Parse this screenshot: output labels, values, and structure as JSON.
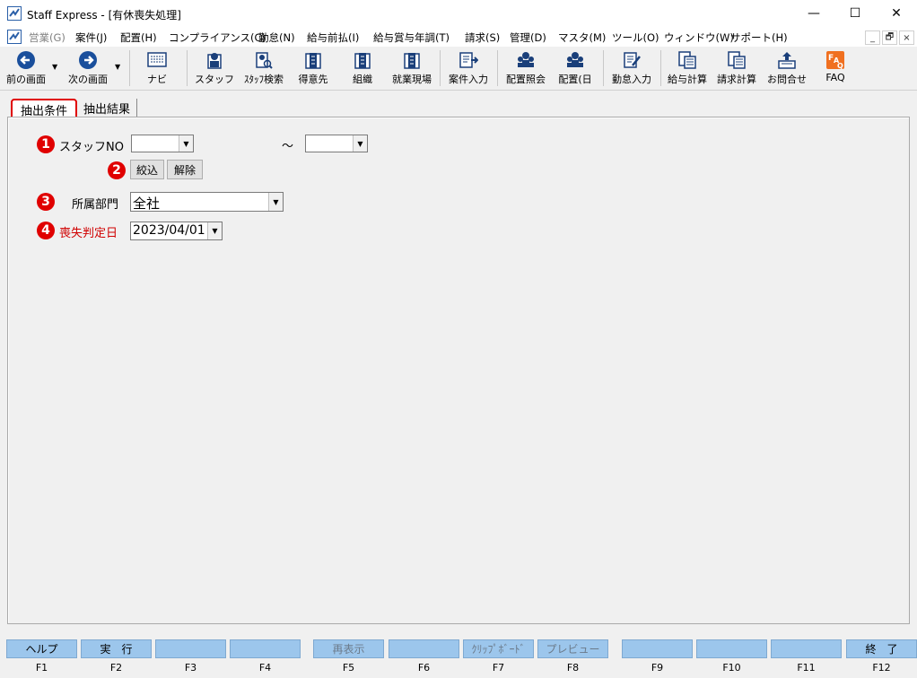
{
  "window": {
    "title": "Staff Express - [有休喪失処理]",
    "controls": {
      "minimize": "—",
      "maximize": "☐",
      "close": "✕"
    }
  },
  "menu": {
    "items": [
      "営業(G)",
      "案件(J)",
      "配置(H)",
      "コンプライアンス(C)",
      "勤怠(N)",
      "給与前払(I)",
      "給与賞与年調(T)",
      "請求(S)",
      "管理(D)",
      "マスタ(M)",
      "ツール(O)",
      "ウィンドウ(W)",
      "サポート(H)"
    ],
    "mdi": {
      "minimize": "_",
      "restore": "🗗",
      "close": "×"
    }
  },
  "toolbar": {
    "items": [
      {
        "label": "前の画面",
        "icon": "back-arrow-icon"
      },
      {
        "label": "次の画面",
        "icon": "forward-arrow-icon"
      },
      {
        "label": "ナビ",
        "icon": "navi-keyboard-icon"
      },
      {
        "label": "スタッフ",
        "icon": "staff-icon"
      },
      {
        "label": "ｽﾀｯﾌ検索",
        "icon": "staff-search-icon"
      },
      {
        "label": "得意先",
        "icon": "client-icon"
      },
      {
        "label": "組織",
        "icon": "organization-icon"
      },
      {
        "label": "就業現場",
        "icon": "worksite-icon"
      },
      {
        "label": "案件入力",
        "icon": "project-entry-icon"
      },
      {
        "label": "配置照会",
        "icon": "placement-inquiry-icon"
      },
      {
        "label": "配置(日",
        "icon": "placement-daily-icon"
      },
      {
        "label": "勤怠入力",
        "icon": "attendance-entry-icon"
      },
      {
        "label": "給与計算",
        "icon": "payroll-icon"
      },
      {
        "label": "請求計算",
        "icon": "billing-icon"
      },
      {
        "label": "お問合せ",
        "icon": "inquiry-icon"
      },
      {
        "label": "FAQ",
        "icon": "faq-icon"
      }
    ]
  },
  "tabs": {
    "conditions": "抽出条件",
    "results": "抽出結果"
  },
  "form": {
    "markers": [
      "1",
      "2",
      "3",
      "4"
    ],
    "staff_no_label": "スタッフNO",
    "staff_no_from": "",
    "range_sep": "～",
    "staff_no_to": "",
    "filter_button": "絞込",
    "clear_button": "解除",
    "department_label": "所属部門",
    "department_value": "全社",
    "loss_date_label": "喪失判定日",
    "loss_date_value": "2023/04/01",
    "colors": {
      "marker": "#e00000",
      "loss_label": "#d00000"
    }
  },
  "fkeys": [
    {
      "label": "ヘルプ",
      "key": "F1"
    },
    {
      "label": "実　行",
      "key": "F2"
    },
    {
      "label": "",
      "key": "F3"
    },
    {
      "label": "",
      "key": "F4"
    },
    {
      "label": "再表示",
      "key": "F5"
    },
    {
      "label": "",
      "key": "F6"
    },
    {
      "label": "ｸﾘｯﾌﾟﾎﾞｰﾄﾞ",
      "key": "F7"
    },
    {
      "label": "プレビュー",
      "key": "F8"
    },
    {
      "label": "",
      "key": "F9"
    },
    {
      "label": "",
      "key": "F10"
    },
    {
      "label": "",
      "key": "F11"
    },
    {
      "label": "終　了",
      "key": "F12"
    }
  ]
}
